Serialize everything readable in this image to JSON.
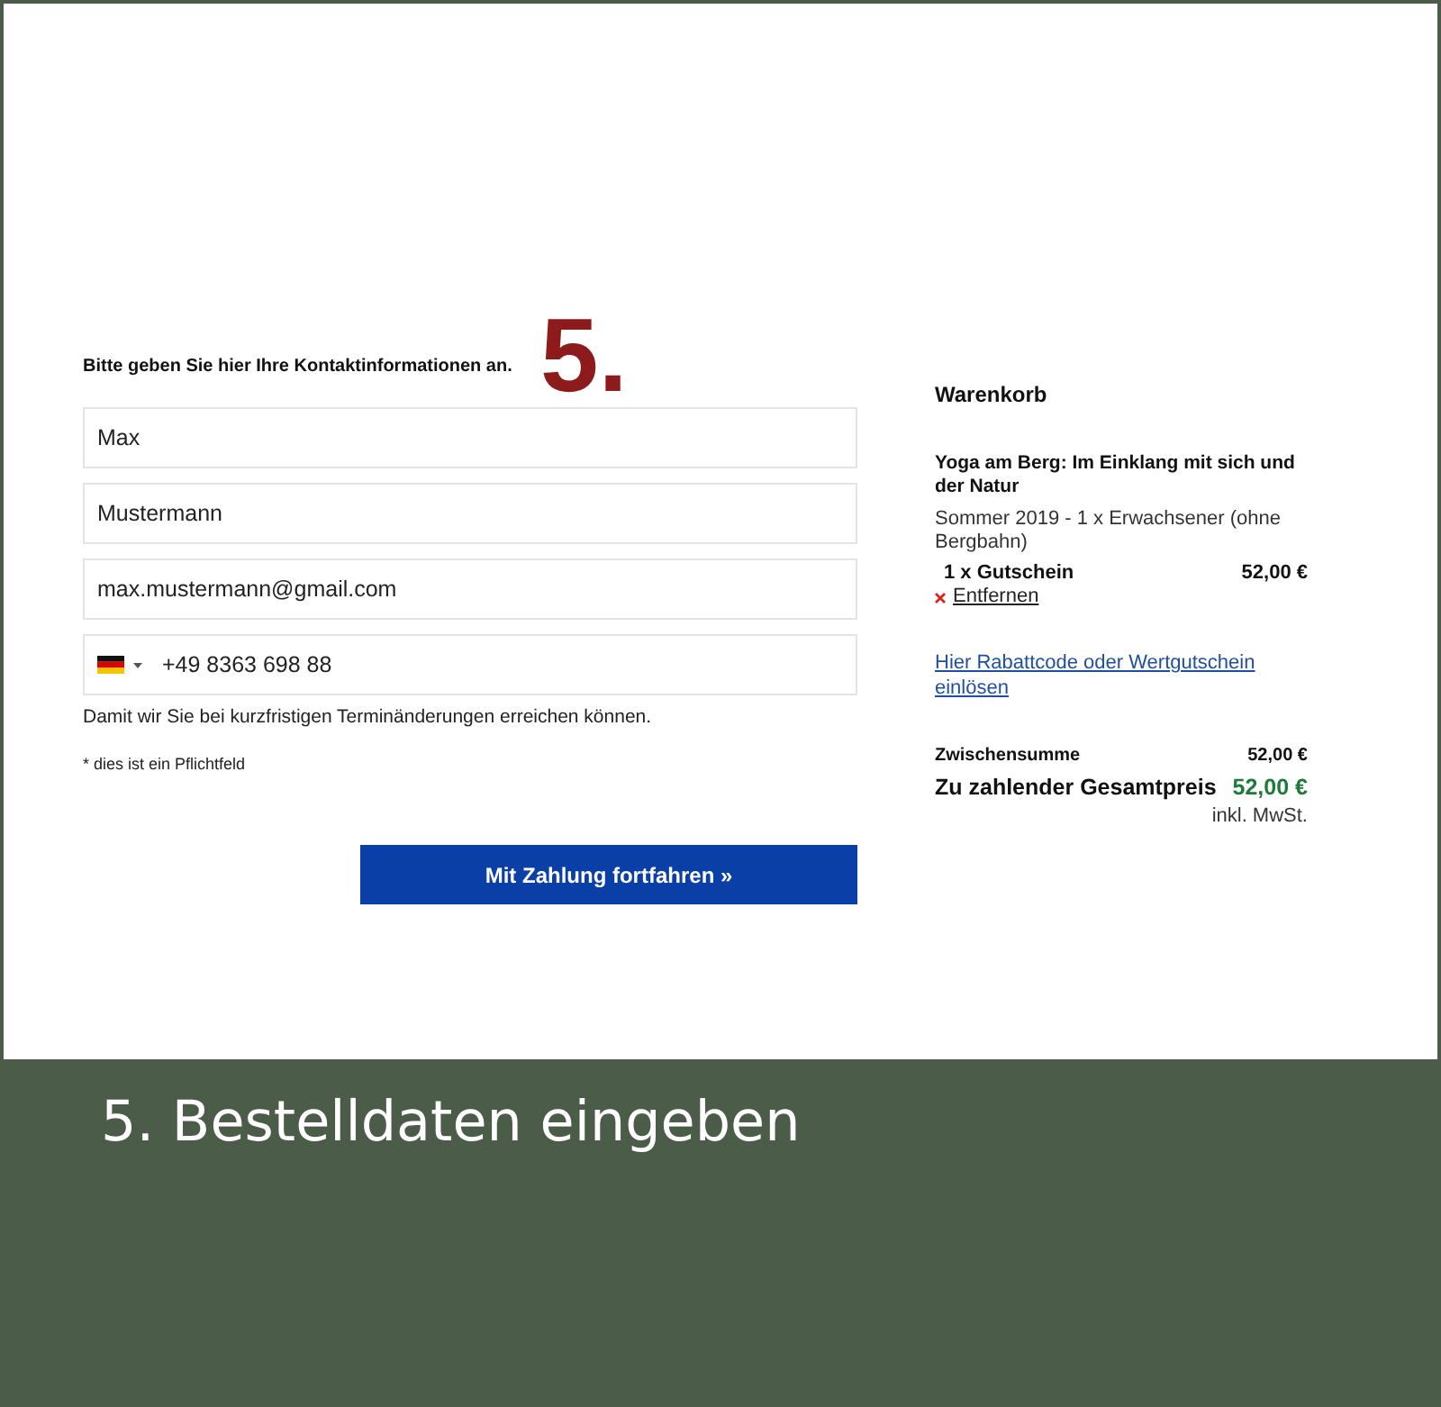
{
  "step_marker": "5.",
  "form": {
    "heading": "Bitte geben Sie hier Ihre Kontaktinformationen an.",
    "fields": [
      {
        "kind": "text",
        "value": "Max"
      },
      {
        "kind": "text",
        "value": "Mustermann"
      },
      {
        "kind": "text",
        "value": "max.mustermann@gmail.com"
      },
      {
        "kind": "phone",
        "value": "+49 8363 698 88"
      }
    ],
    "hint": "Damit wir Sie bei kurzfristigen Terminänderungen erreichen können.",
    "required_note": "* dies ist ein Pflichtfeld",
    "submit_button": "Mit Zahlung fortfahren »"
  },
  "cart": {
    "title": "Warenkorb",
    "items": [
      {
        "title": "Yoga am Berg: Im Einklang mit sich und der Natur",
        "details": "Sommer 2019 - 1 x Erwachsener (ohne Bergbahn)",
        "line": "1 x Gutschein",
        "price": "52,00 €",
        "remove": "Entfernen"
      }
    ],
    "voucher_link": "Hier Rabattcode oder Wertgutschein einlösen",
    "subtotal": {
      "label": "Zwischensumme",
      "value": "52,00 €"
    },
    "total": {
      "label": "Zu zahlender Gesamtpreis",
      "value": "52,00 €"
    },
    "tax_note": "inkl. MwSt."
  },
  "caption": "5. Bestelldaten eingeben"
}
